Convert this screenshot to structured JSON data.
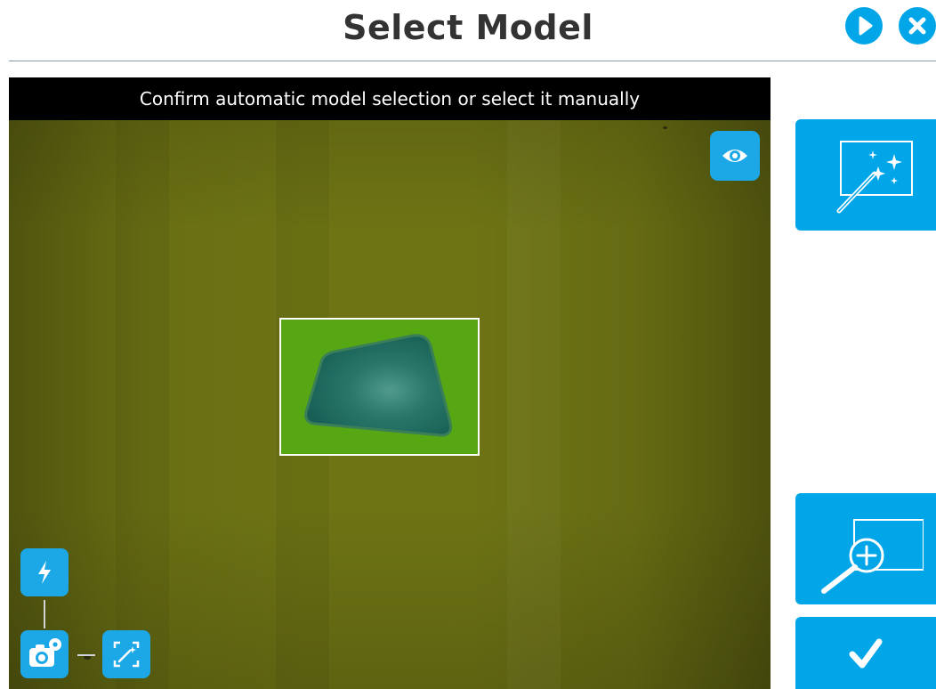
{
  "header": {
    "title": "Select Model",
    "next_icon": "play-icon",
    "close_icon": "close-icon"
  },
  "viewer": {
    "banner": "Confirm automatic model selection or select it manually",
    "eye_icon": "eye-icon"
  },
  "tools": {
    "flash_icon": "flash-icon",
    "camera_settings_icon": "camera-settings-icon",
    "auto_focus_icon": "magic-frame-icon"
  },
  "sidebar": {
    "auto_select_icon": "magic-wand-sparkles-icon",
    "zoom_icon": "zoom-in-icon",
    "confirm_icon": "checkmark-icon"
  },
  "colors": {
    "accent": "#00a6e8",
    "camera_bg": "#6e7414",
    "selection_fill": "#57a614",
    "part": "#1e6e62"
  }
}
